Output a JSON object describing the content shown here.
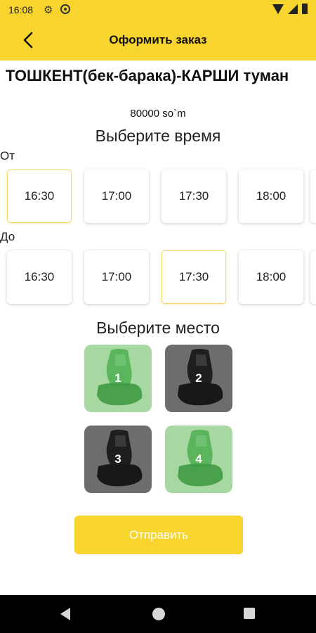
{
  "status_bar": {
    "time": "16:08",
    "icons": [
      "gear-icon",
      "sync-icon",
      "wifi-icon",
      "signal-icon",
      "battery-icon"
    ]
  },
  "app_bar": {
    "title": "Оформить заказ",
    "back_icon": "arrow-left-icon"
  },
  "route": {
    "title": "ТОШКЕНТ(бек-барака)-КАРШИ туман",
    "price": "80000 so`m"
  },
  "time_section": {
    "title": "Выберите время",
    "from_label": "От",
    "to_label": "До",
    "from_times": [
      "16:30",
      "17:00",
      "17:30",
      "18:00"
    ],
    "to_times": [
      "16:30",
      "17:00",
      "17:30",
      "18:00"
    ],
    "from_selected": "16:30",
    "to_selected": "17:30"
  },
  "seat_section": {
    "title": "Выберите место",
    "seats": [
      {
        "number": "1",
        "status": "free"
      },
      {
        "number": "2",
        "status": "taken"
      },
      {
        "number": "3",
        "status": "taken"
      },
      {
        "number": "4",
        "status": "free"
      }
    ]
  },
  "submit_label": "Отправить",
  "colors": {
    "accent": "#f8d42e",
    "seat_free": "#a8d8a2",
    "seat_taken": "#6d6d6d",
    "selected_border": "#f5d76e"
  }
}
